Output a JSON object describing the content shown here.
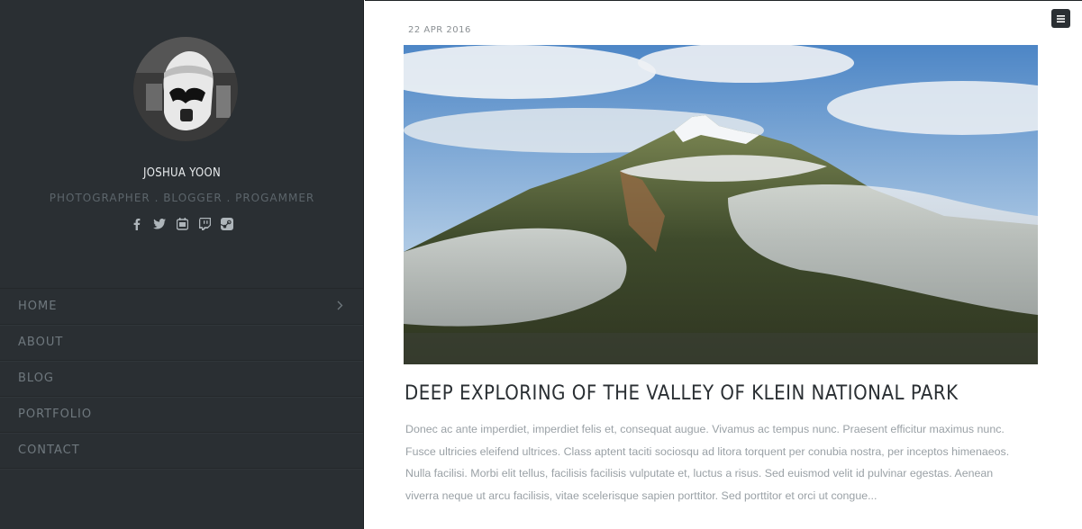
{
  "profile": {
    "name": "JOSHUA YOON",
    "tagline": "PHOTOGRAPHER . BLOGGER . PROGAMMER",
    "socials": [
      "facebook-icon",
      "twitter-icon",
      "youtube-icon",
      "twitch-icon",
      "steam-icon"
    ]
  },
  "nav": {
    "items": [
      {
        "label": "HOME"
      },
      {
        "label": "ABOUT"
      },
      {
        "label": "BLOG"
      },
      {
        "label": "PORTFOLIO"
      },
      {
        "label": "CONTACT"
      }
    ]
  },
  "post": {
    "date": "22 APR 2016",
    "title": "DEEP EXPLORING OF THE VALLEY OF KLEIN NATIONAL PARK",
    "excerpt": "Donec ac ante imperdiet, imperdiet felis et, consequat augue. Vivamus ac tempus nunc. Praesent efficitur maximus nunc. Fusce ultricies eleifend ultrices. Class aptent taciti sociosqu ad litora torquent per conubia nostra, per inceptos himenaeos. Nulla facilisi. Morbi elit tellus, facilisis facilisis vulputate et, luctus a risus. Sed euismod velit id pulvinar egestas. Aenean viverra neque ut arcu facilisis, vitae scelerisque sapien porttitor. Sed porttitor et orci ut congue..."
  },
  "colors": {
    "sidebar_bg": "#2a2f33",
    "nav_text": "#6f787e",
    "title_text": "#2a2f33",
    "body_text": "#9aa1a6"
  }
}
